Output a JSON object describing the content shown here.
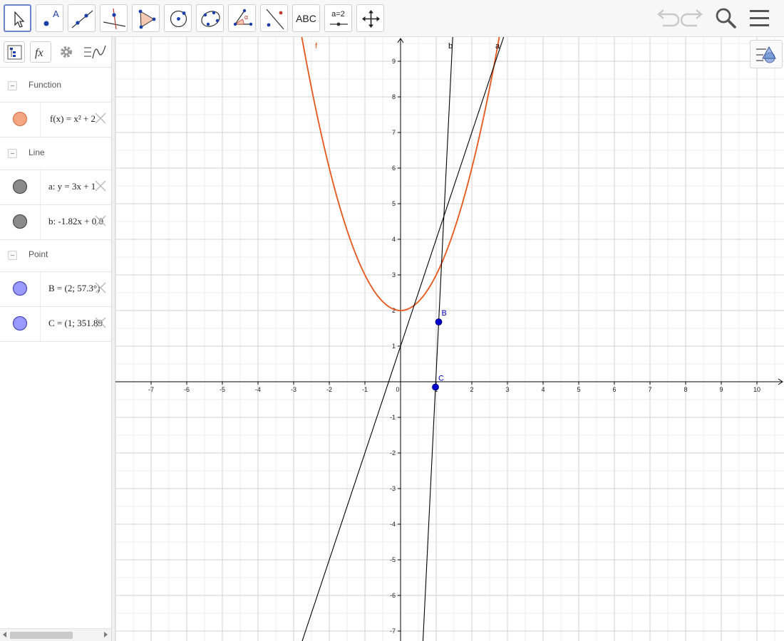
{
  "toolbar": {
    "tools": [
      {
        "name": "move-tool",
        "label": ""
      },
      {
        "name": "point-tool",
        "label": "A"
      },
      {
        "name": "line-tool",
        "label": ""
      },
      {
        "name": "perpendicular-line-tool",
        "label": ""
      },
      {
        "name": "polygon-tool",
        "label": ""
      },
      {
        "name": "circle-center-point-tool",
        "label": ""
      },
      {
        "name": "conic-five-points-tool",
        "label": ""
      },
      {
        "name": "angle-tool",
        "label": "α"
      },
      {
        "name": "reflect-about-line-tool",
        "label": ""
      },
      {
        "name": "text-tool",
        "label": "ABC"
      },
      {
        "name": "slider-tool",
        "label": "a=2"
      },
      {
        "name": "move-graphics-view-tool",
        "label": ""
      }
    ],
    "right_icons": [
      "undo-icon",
      "redo-icon",
      "search-icon",
      "menu-icon"
    ]
  },
  "algebra": {
    "tab_icons": [
      "sort-icon",
      "fx-icon",
      "gear-icon",
      "graph-style-icon"
    ],
    "groups": [
      {
        "label": "Function",
        "items": [
          {
            "text": "f(x) = x² + 2",
            "color": "#f4a582"
          }
        ]
      },
      {
        "label": "Line",
        "items": [
          {
            "text": "a: y = 3x + 1",
            "color": "#8a8a8a"
          },
          {
            "text": "b: -1.82x + 0.0",
            "color": "#8a8a8a"
          }
        ]
      },
      {
        "label": "Point",
        "items": [
          {
            "text": "B = (2; 57.3°)",
            "color": "#9999ff"
          },
          {
            "text": "C = (1; 351.89",
            "color": "#9999ff"
          }
        ]
      }
    ]
  },
  "graph": {
    "x_ticks": [
      -7,
      -6,
      -5,
      -4,
      -3,
      -2,
      -1,
      0,
      1,
      2,
      3,
      4,
      5,
      6,
      7,
      8,
      9,
      10
    ],
    "y_ticks": [
      -7,
      -6,
      -5,
      -4,
      -3,
      -2,
      -1,
      1,
      2,
      3,
      4,
      5,
      6,
      7,
      8,
      9
    ],
    "xlim": [
      -8,
      10.6
    ],
    "ylim": [
      -7.1,
      9.7
    ],
    "grid": true,
    "curve_labels": {
      "f": "f",
      "a": "a",
      "b": "b"
    },
    "points": [
      {
        "label": "B",
        "x": 1.07,
        "y": 1.68
      },
      {
        "label": "C",
        "x": 0.98,
        "y": -0.15
      }
    ],
    "colors": {
      "function": "#e8561a",
      "lines": "#000000",
      "points": "#0000cc",
      "grid": "#d9d9d9",
      "axes": "#000000"
    }
  }
}
